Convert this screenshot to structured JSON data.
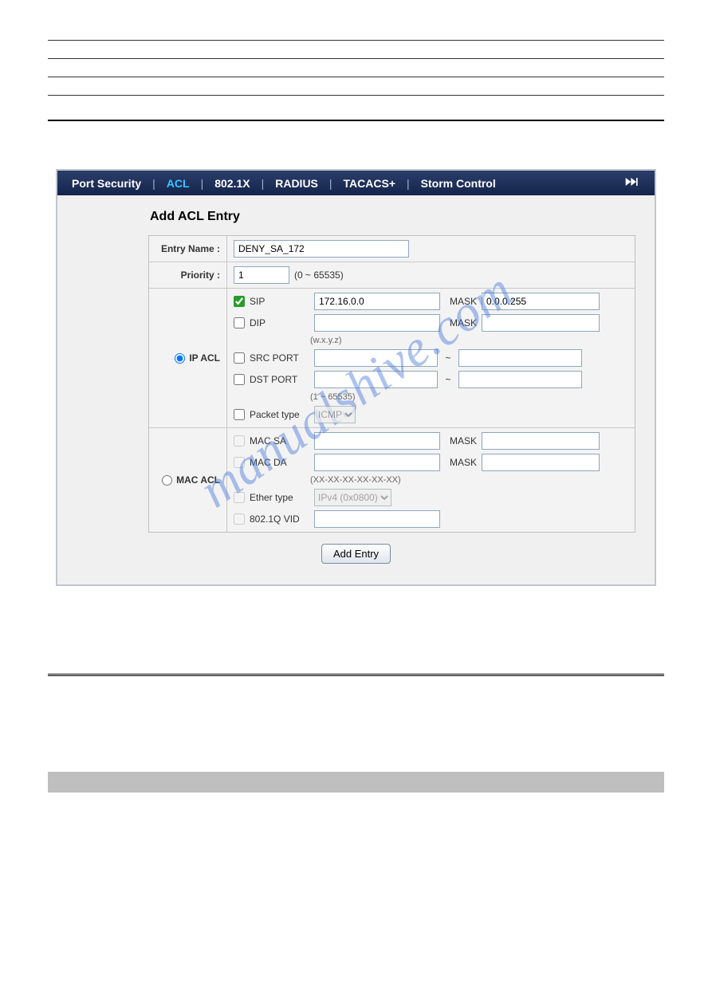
{
  "tabs": [
    "Port Security",
    "ACL",
    "802.1X",
    "RADIUS",
    "TACACS+",
    "Storm Control"
  ],
  "activeTab": 1,
  "title": "Add ACL Entry",
  "labels": {
    "entryName": "Entry Name :",
    "priority": "Priority :",
    "ipacl": "IP ACL",
    "macacl": "MAC ACL"
  },
  "fields": {
    "entryName": "DENY_SA_172",
    "priority": "1",
    "priorityHint": "(0 ~ 65535)",
    "sip": {
      "label": "SIP",
      "checked": true,
      "value": "172.16.0.0",
      "maskLabel": "MASK",
      "mask": "0.0.0.255"
    },
    "dip": {
      "label": "DIP",
      "checked": false,
      "value": "",
      "maskLabel": "MASK",
      "mask": ""
    },
    "ipHint": "(w.x.y.z)",
    "srcport": {
      "label": "SRC PORT",
      "checked": false,
      "from": "",
      "to": ""
    },
    "dstport": {
      "label": "DST PORT",
      "checked": false,
      "from": "",
      "to": ""
    },
    "portHint": "(1 ~ 65535)",
    "pkttype": {
      "label": "Packet type",
      "checked": false,
      "value": "ICMP"
    },
    "macsa": {
      "label": "MAC SA",
      "checked": false,
      "value": "",
      "maskLabel": "MASK",
      "mask": ""
    },
    "macda": {
      "label": "MAC DA",
      "checked": false,
      "value": "",
      "maskLabel": "MASK",
      "mask": ""
    },
    "macHint": "(XX-XX-XX-XX-XX-XX)",
    "ethtype": {
      "label": "Ether type",
      "checked": false,
      "value": "IPv4 (0x0800)"
    },
    "vid": {
      "label": "802.1Q VID",
      "checked": false,
      "value": ""
    }
  },
  "buttons": {
    "add": "Add Entry"
  },
  "aclSelected": "ip",
  "watermark": "manualshive.com"
}
